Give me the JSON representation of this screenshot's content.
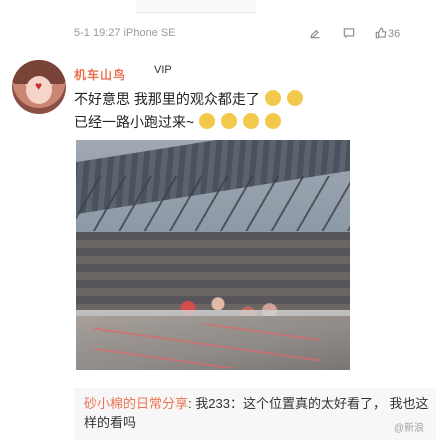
{
  "post_meta": {
    "timestamp": "5-1 19:27",
    "device": "iPhone SE",
    "like_count": "36",
    "icons": [
      "edit-icon",
      "comment-icon",
      "like-icon"
    ]
  },
  "comment": {
    "username": "机车山鸟",
    "vip_badge": "VIP",
    "text_line_1": "不好意思 我那里的观众都走了",
    "text_line_2": "已经一路小跑过来~",
    "emoji_count": 4
  },
  "photo": {
    "description_type": "stadium-photo"
  },
  "retweet": {
    "user": "砂小棉的日常分享",
    "text": "我233：这个位置真的太好看了， 我也这样的看吗"
  },
  "watermark": {
    "text": "@新浪"
  }
}
